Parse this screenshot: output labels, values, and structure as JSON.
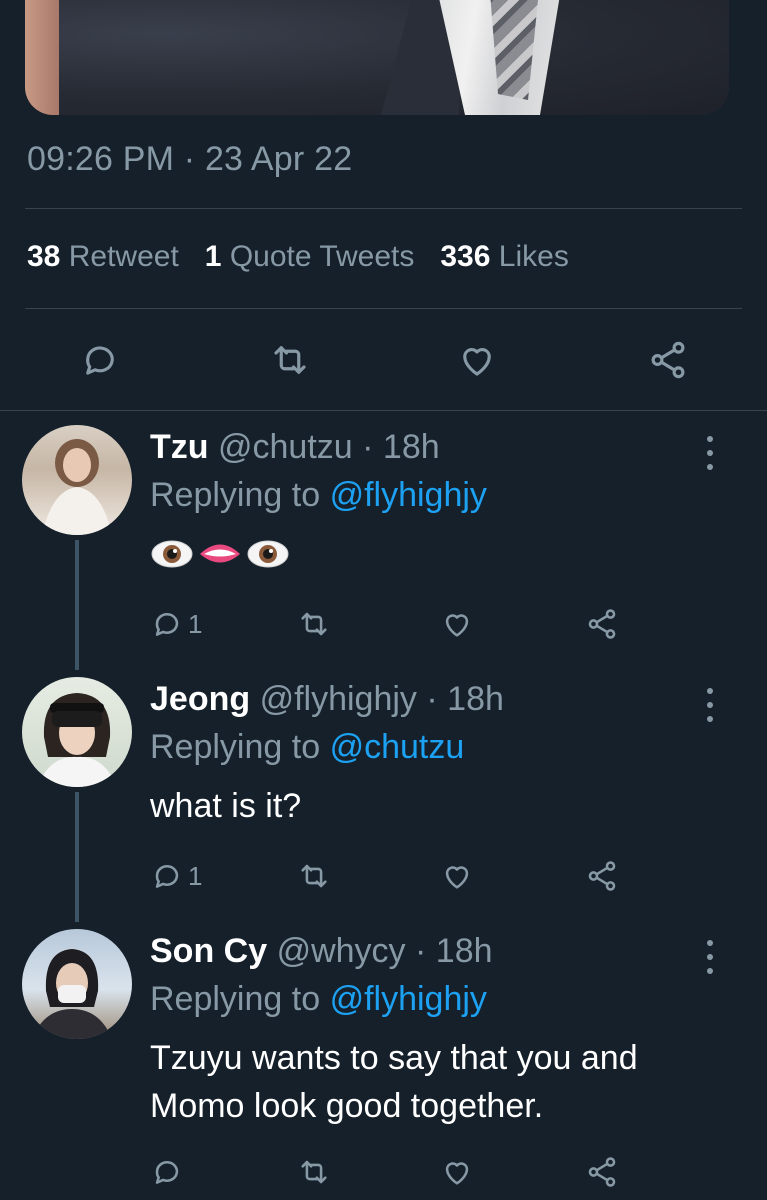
{
  "tweet": {
    "timestamp": "09:26 PM · 23 Apr 22",
    "stats": {
      "retweets_count": "38",
      "retweets_label": "Retweet",
      "quotes_count": "1",
      "quotes_label": "Quote Tweets",
      "likes_count": "336",
      "likes_label": "Likes"
    },
    "actions": [
      "reply-icon",
      "retweet-icon",
      "like-icon",
      "share-icon"
    ]
  },
  "colors": {
    "background": "#15202b",
    "secondary_text": "#8899a6",
    "accent": "#1da1f2",
    "divider": "#38444d"
  },
  "replies": [
    {
      "name": "Tzu",
      "handle": "@chutzu",
      "time": "· 18h",
      "replying_label": "Replying to",
      "replying_to": "@flyhighjy",
      "text": "",
      "emojis": [
        "eyes-emoji",
        "mouth-emoji",
        "eyes-emoji"
      ],
      "reply_count": "1"
    },
    {
      "name": "Jeong",
      "handle": "@flyhighjy",
      "time": "· 18h",
      "replying_label": "Replying to",
      "replying_to": "@chutzu",
      "text": "what is it?",
      "reply_count": "1"
    },
    {
      "name": "Son Cy",
      "handle": "@whycy",
      "time": "· 18h",
      "replying_label": "Replying to",
      "replying_to": "@flyhighjy",
      "text_line1": "Tzuyu wants to say that you and",
      "text_line2": "Momo look good together.",
      "reply_count": ""
    }
  ]
}
